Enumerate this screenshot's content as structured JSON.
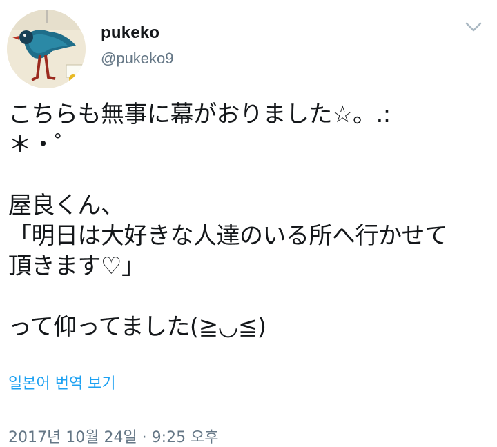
{
  "user": {
    "display_name": "pukeko",
    "username": "@pukeko9"
  },
  "icons": {
    "avatar": "pukeko-bird-avatar",
    "menu": "chevron-down-icon"
  },
  "tweet": {
    "lines": [
      "こちらも無事に幕がおりました☆。.:",
      "＊・゜",
      "",
      "屋良くん、",
      "「明日は大好きな人達のいる所へ行かせて",
      "頂きます♡」",
      "",
      "って仰ってました(≧◡≦)"
    ]
  },
  "translate_label": "일본어 번역 보기",
  "timestamp": "2017년 10월 24일 · 9:25 오후",
  "colors": {
    "link": "#1da1f2",
    "secondary_text": "#657786",
    "primary_text": "#14171a"
  }
}
